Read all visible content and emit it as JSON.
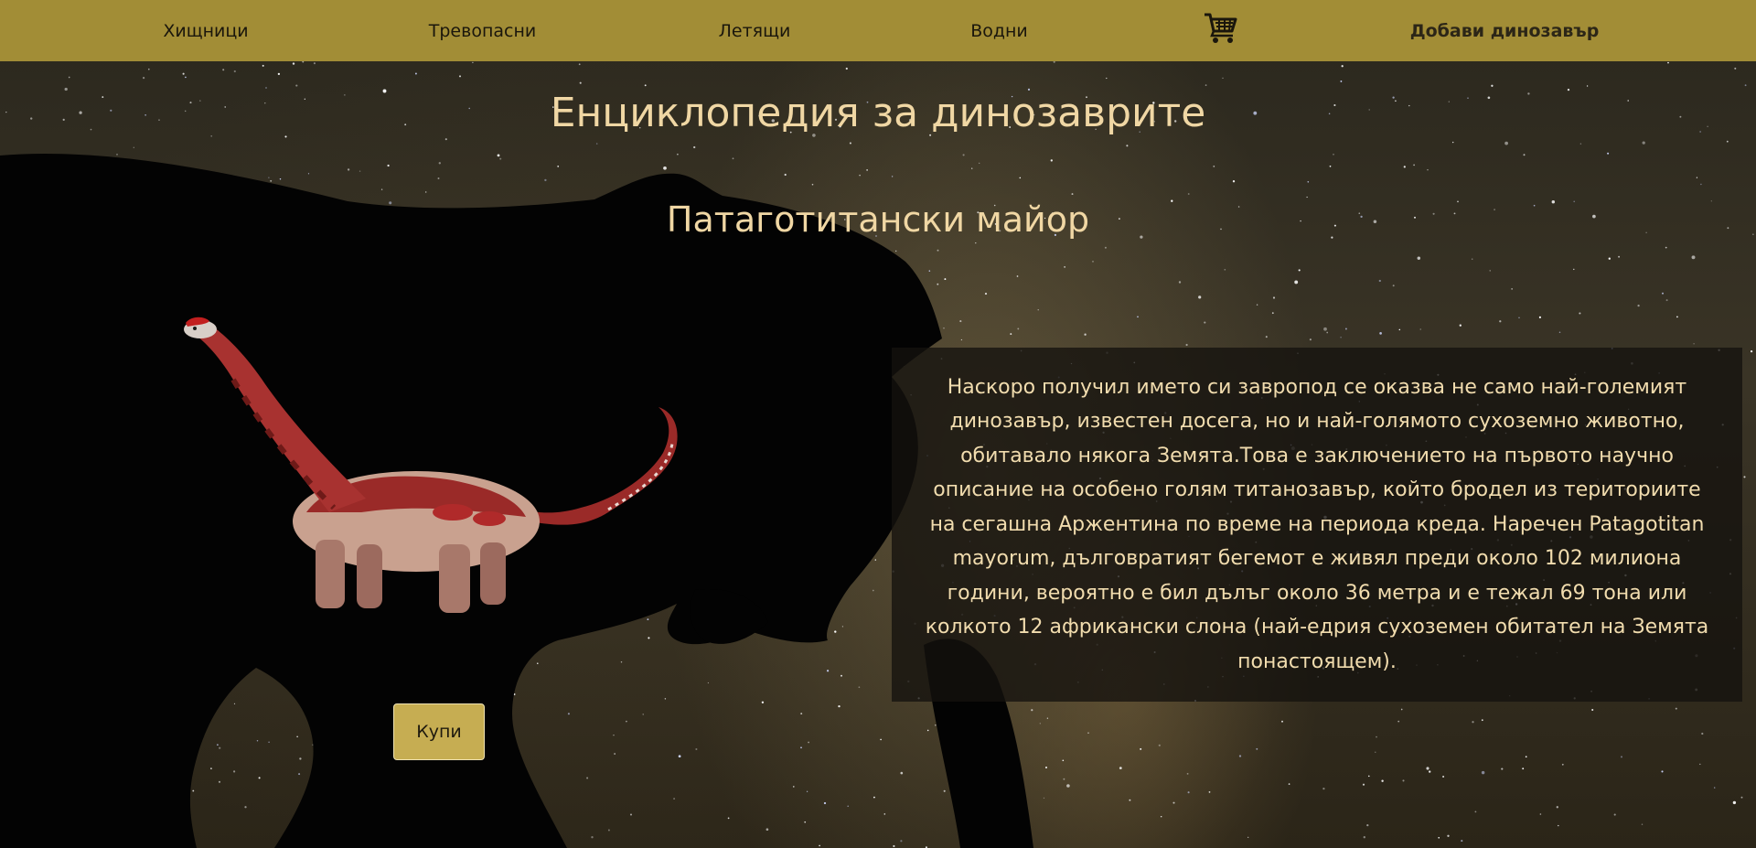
{
  "nav": {
    "items": [
      {
        "label": "Хищници"
      },
      {
        "label": "Тревопасни"
      },
      {
        "label": "Летящи"
      },
      {
        "label": "Водни"
      }
    ],
    "cart_icon": "shopping-cart-icon",
    "add_label": "Добави динозавър"
  },
  "page": {
    "title": "Енциклопедия за динозаврите",
    "dinosaur_name": "Патаготитански майор",
    "description": "Наскоро получил името си завропод се оказва не само най-големият динозавър, известен досега, но и най-голямото сухоземно животно, обитавало някога Земята.Това е заключението на първото научно описание на особено голям титанозавър, който бродел из териториите на сегашна Аржентина по време на периода креда. Наречен Patagotitan mayorum, дълговратият бегемот е живял преди около 102 милиона години, вероятно е бил дълъг около 36 метра и е тежал 69 тона или колкото 12 африкански слона (най-едрия сухоземен обитател на Земята понастоящем).",
    "buy_label": "Купи"
  },
  "colors": {
    "navbar": "#a28d36",
    "title_text": "#f0d7a4",
    "button": "#c6ad52",
    "dinosaur_red": "#b02a2a"
  }
}
